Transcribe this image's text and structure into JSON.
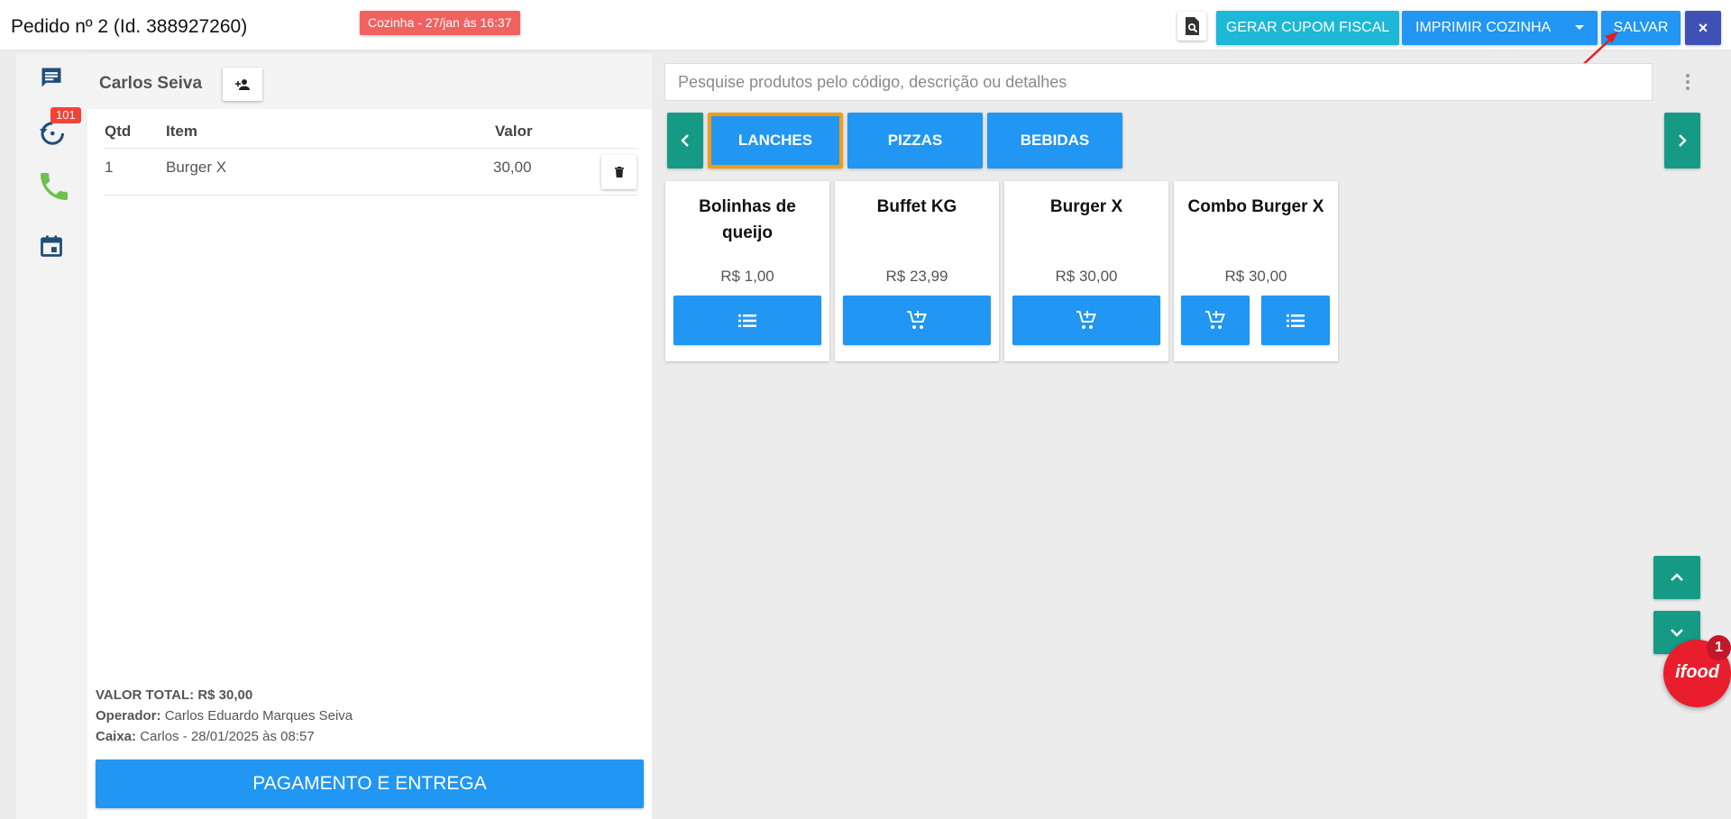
{
  "header": {
    "title": "Pedido nº 2 (Id. 388927260)",
    "kitchen_badge": "Cozinha - 27/jan às 16:37",
    "fiscal_label": "GERAR CUPOM FISCAL",
    "print_kitchen_label": "IMPRIMIR COZINHA",
    "save_label": "SALVAR",
    "close_label": "×"
  },
  "rail": {
    "history_badge": "101",
    "icons": [
      "chat-icon",
      "history-icon",
      "phone-icon",
      "calendar-icon"
    ]
  },
  "order": {
    "customer_name": "Carlos Seiva",
    "columns": {
      "qty": "Qtd",
      "item": "Item",
      "value": "Valor"
    },
    "items": [
      {
        "qty": "1",
        "item": "Burger X",
        "value": "30,00"
      }
    ],
    "summary": {
      "total_label": "VALOR TOTAL:",
      "total_value": "R$ 30,00",
      "operator_label": "Operador:",
      "operator_value": "Carlos Eduardo Marques Seiva",
      "cashier_label": "Caixa:",
      "cashier_value": "Carlos - 28/01/2025 às 08:57"
    },
    "pay_button_label": "PAGAMENTO E ENTREGA"
  },
  "search": {
    "placeholder": "Pesquise produtos pelo código, descrição ou detalhes"
  },
  "categories": [
    {
      "label": "LANCHES",
      "active": true
    },
    {
      "label": "PIZZAS",
      "active": false
    },
    {
      "label": "BEBIDAS",
      "active": false
    }
  ],
  "products": [
    {
      "name": "Bolinhas de queijo",
      "price": "R$ 1,00",
      "buttons": [
        "list-icon"
      ]
    },
    {
      "name": "Buffet KG",
      "price": "R$ 23,99",
      "buttons": [
        "cart-add-icon"
      ]
    },
    {
      "name": "Burger X",
      "price": "R$ 30,00",
      "buttons": [
        "cart-add-icon"
      ]
    },
    {
      "name": "Combo Burger X",
      "price": "R$ 30,00",
      "buttons": [
        "cart-add-icon",
        "list-icon"
      ]
    }
  ],
  "ifood": {
    "label": "ifood",
    "badge": "1"
  },
  "colors": {
    "primary": "#2196f3",
    "teal": "#159a86",
    "cyan": "#1cb8d6",
    "indigo": "#3f51b5",
    "badge_red": "#f0625f",
    "active_border": "#f39c12",
    "ifood_red": "#ea1d2c"
  }
}
